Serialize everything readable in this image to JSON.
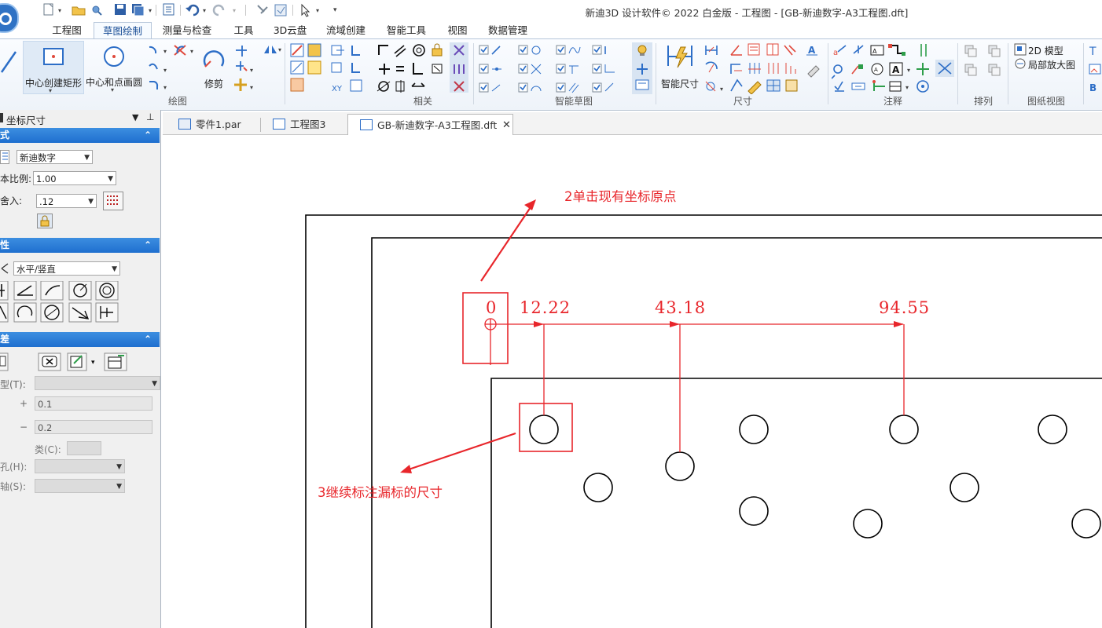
{
  "window": {
    "title": "新迪3D 设计软件© 2022 白金版 - 工程图 - [GB-新迪数字-A3工程图.dft]"
  },
  "ribbon": {
    "tabs": [
      {
        "label": "工程图",
        "active": false
      },
      {
        "label": "草图绘制",
        "active": true
      },
      {
        "label": "测量与检查",
        "active": false
      },
      {
        "label": "工具",
        "active": false
      },
      {
        "label": "3D云盘",
        "active": false
      },
      {
        "label": "流域创建",
        "active": false
      },
      {
        "label": "智能工具",
        "active": false
      },
      {
        "label": "视图",
        "active": false
      },
      {
        "label": "数据管理",
        "active": false
      }
    ],
    "buttons": {
      "center_rect": "中心创建矩形",
      "center_circle": "中心和点画圆",
      "trim": "修剪",
      "smart_dim": "智能尺寸",
      "model_2d": "2D 模型",
      "detail_view": "局部放大图"
    },
    "groups": {
      "draw": "绘图",
      "relate": "相关",
      "smart_sketch": "智能草图",
      "dimension": "尺寸",
      "annotation": "注释",
      "arrange": "排列",
      "drawing_view": "图纸视图"
    }
  },
  "panel": {
    "title": "坐标尺寸",
    "sections": {
      "style": "式",
      "props": "性",
      "tolerance": "差"
    },
    "style_value": "新迪数字",
    "scale_label": "本比例:",
    "scale_value": "1.00",
    "round_label": "舍入:",
    "round_value": ".12",
    "orient_value": "水平/竖直",
    "tol_type_label": "型(T):",
    "plus_label": "+",
    "plus_value": "0.1",
    "minus_label": "−",
    "minus_value": "0.2",
    "class_label": "类(C):",
    "hole_label": "孔(H):",
    "shaft_label": "轴(S):"
  },
  "doc_tabs": [
    {
      "label": "零件1.par",
      "active": false
    },
    {
      "label": "工程图3",
      "active": false
    },
    {
      "label": "GB-新迪数字-A3工程图.dft",
      "active": true
    }
  ],
  "drawing": {
    "dims": [
      "0",
      "12.22",
      "43.18",
      "94.55"
    ],
    "annotations": {
      "step2": "2单击现有坐标原点",
      "step3": "3继续标注漏标的尺寸"
    },
    "colors": {
      "annotation": "#e8262b",
      "geometry": "#000000"
    }
  }
}
